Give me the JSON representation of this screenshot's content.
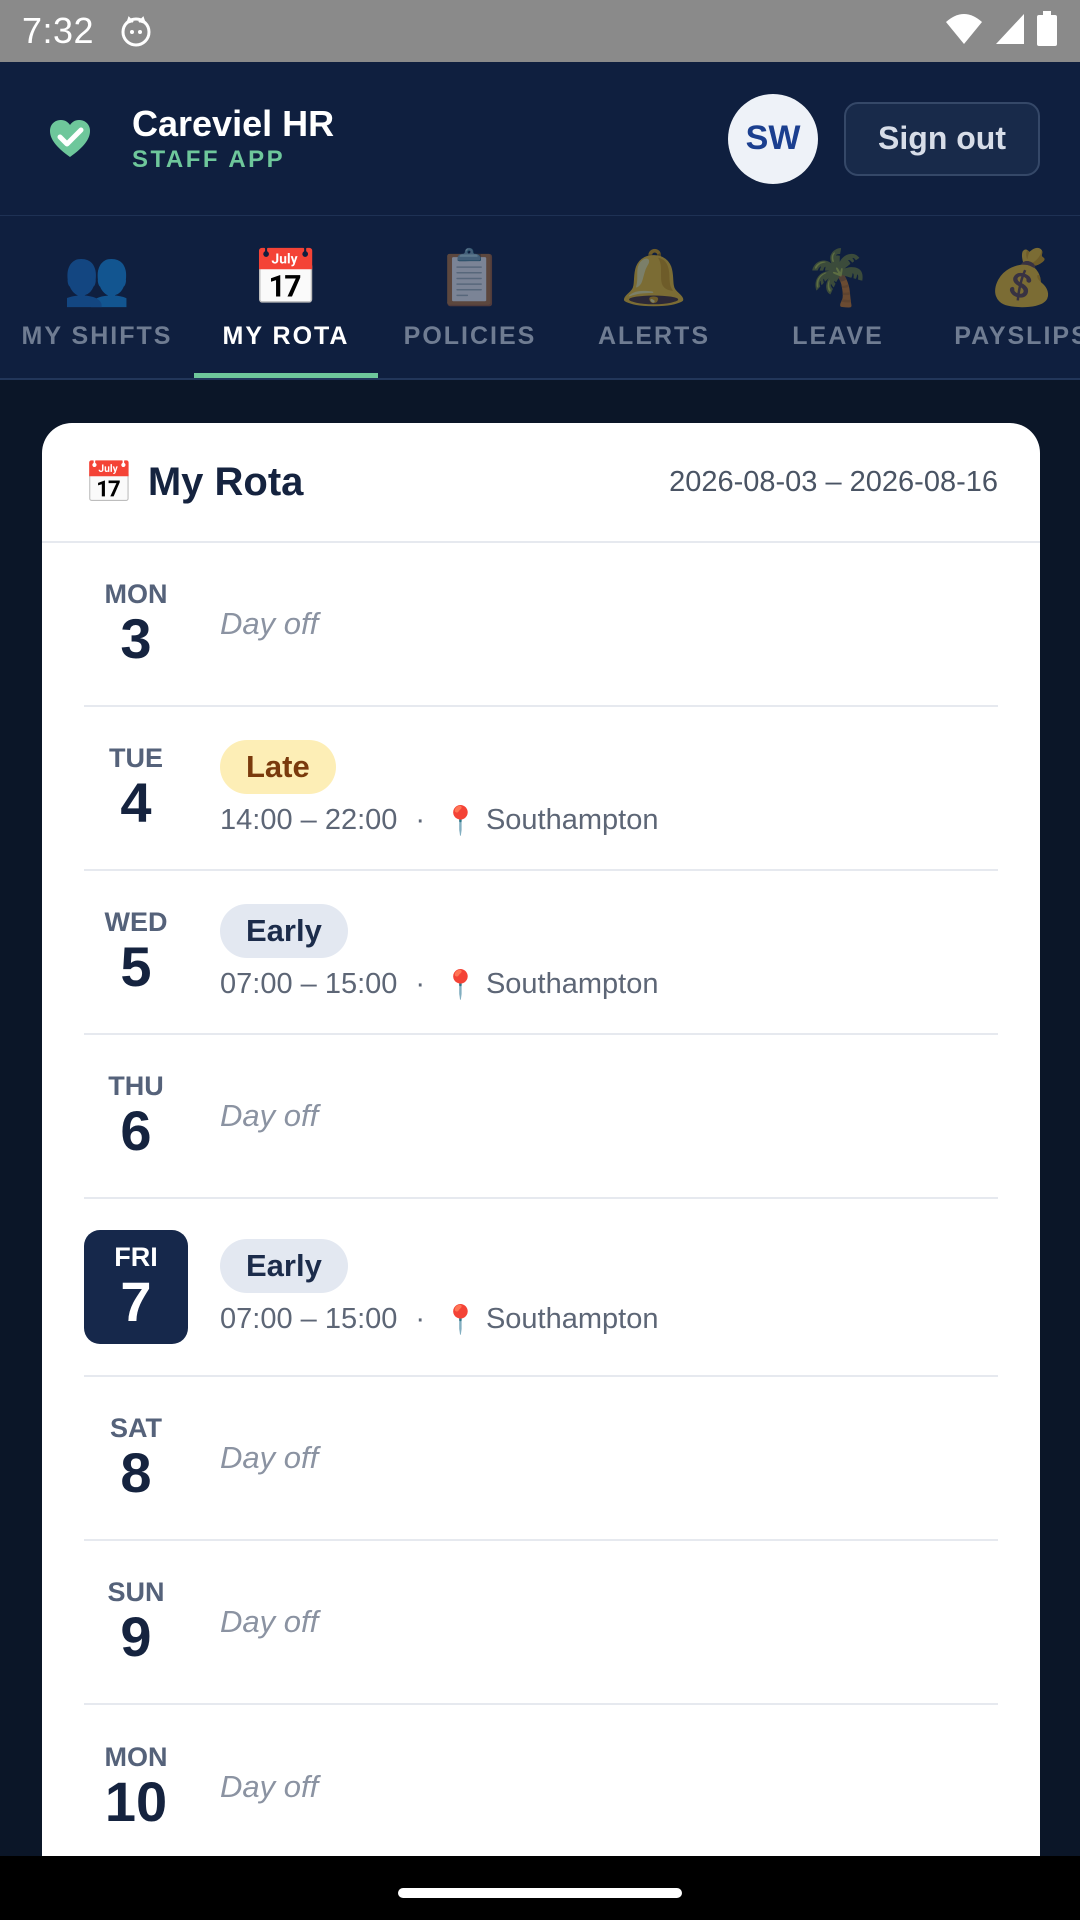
{
  "status_bar": {
    "time": "7:32"
  },
  "header": {
    "app_name": "Careviel HR",
    "app_subtitle": "STAFF APP",
    "avatar_initials": "SW",
    "signout_label": "Sign out",
    "accent_color": "#6ec79b"
  },
  "tabs": [
    {
      "label": "MY SHIFTS",
      "icon": "👥",
      "active": false
    },
    {
      "label": "MY ROTA",
      "icon": "📅",
      "active": true
    },
    {
      "label": "POLICIES",
      "icon": "📋",
      "active": false
    },
    {
      "label": "ALERTS",
      "icon": "🔔",
      "active": false
    },
    {
      "label": "LEAVE",
      "icon": "🌴",
      "active": false
    },
    {
      "label": "PAYSLIPS",
      "icon": "💰",
      "active": false
    }
  ],
  "rota": {
    "title": "My Rota",
    "title_icon": "📅",
    "date_range": "2026-08-03 – 2026-08-16",
    "days": [
      {
        "day": "MON",
        "date": "3",
        "off_text": "Day off"
      },
      {
        "day": "TUE",
        "date": "4",
        "shift": "Late",
        "time": "14:00 – 22:00",
        "separator": "·",
        "location": "Southampton"
      },
      {
        "day": "WED",
        "date": "5",
        "shift": "Early",
        "time": "07:00 – 15:00",
        "separator": "·",
        "location": "Southampton"
      },
      {
        "day": "THU",
        "date": "6",
        "off_text": "Day off"
      },
      {
        "day": "FRI",
        "date": "7",
        "shift": "Early",
        "time": "07:00 – 15:00",
        "separator": "·",
        "location": "Southampton"
      },
      {
        "day": "SAT",
        "date": "8",
        "off_text": "Day off"
      },
      {
        "day": "SUN",
        "date": "9",
        "off_text": "Day off"
      },
      {
        "day": "MON",
        "date": "10",
        "off_text": "Day off"
      }
    ]
  }
}
